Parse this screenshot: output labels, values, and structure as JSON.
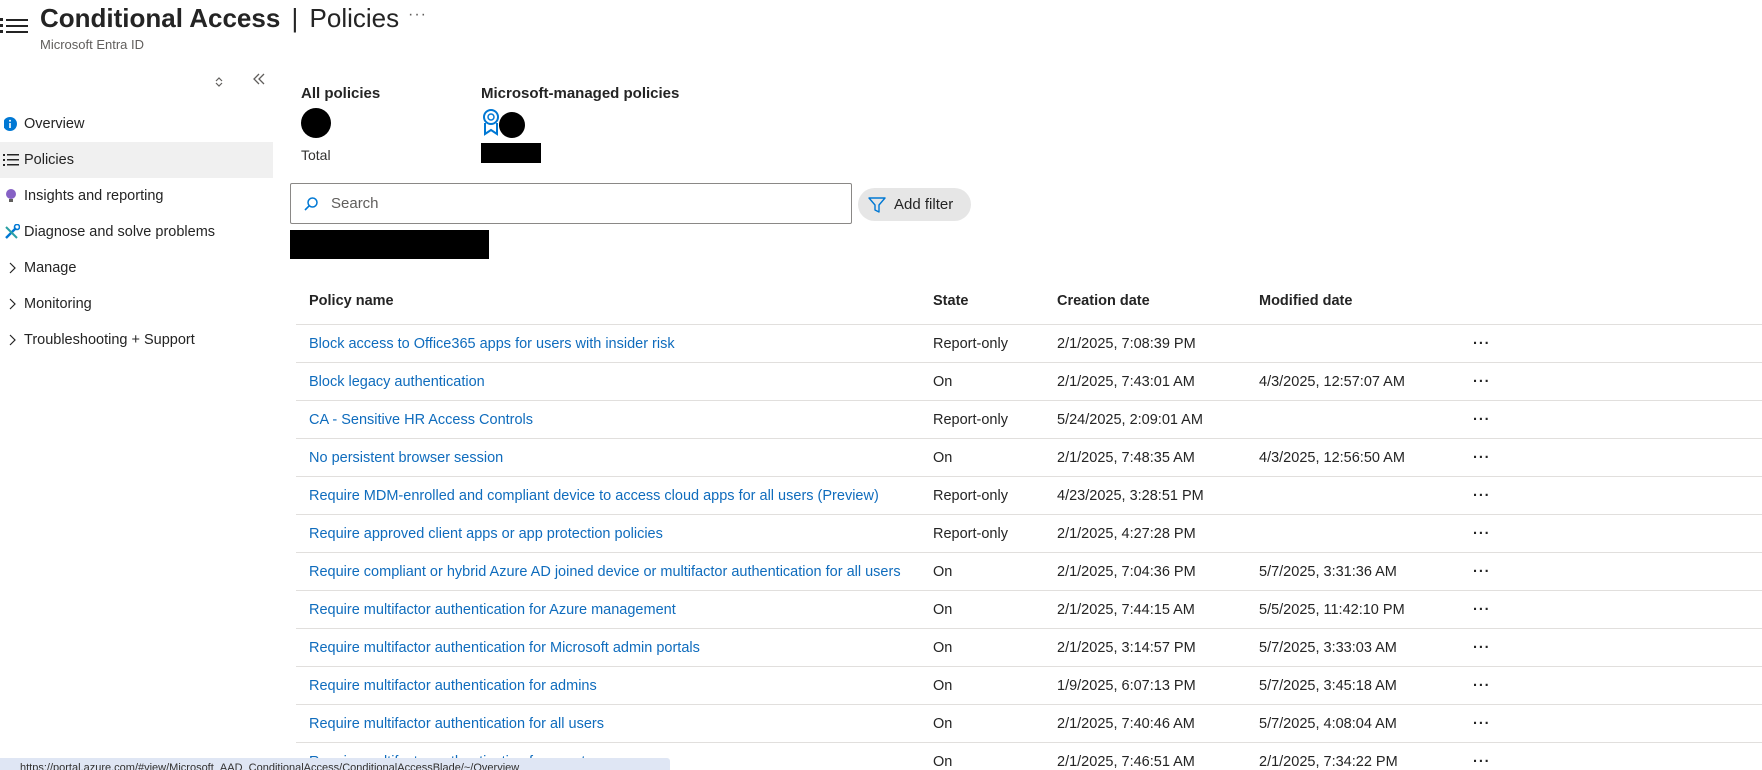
{
  "header": {
    "title_main": "Conditional Access",
    "title_sep": "|",
    "title_sub": "Policies",
    "more": "···",
    "subtitle": "Microsoft Entra ID"
  },
  "sidebar": {
    "items": [
      {
        "label": "Overview",
        "icon": "info-icon",
        "selected": false
      },
      {
        "label": "Policies",
        "icon": "list-icon",
        "selected": true
      },
      {
        "label": "Insights and reporting",
        "icon": "lightbulb-icon",
        "selected": false
      },
      {
        "label": "Diagnose and solve problems",
        "icon": "wrench-icon",
        "selected": false
      },
      {
        "label": "Manage",
        "icon": "chevron-right-icon",
        "selected": false
      },
      {
        "label": "Monitoring",
        "icon": "chevron-right-icon",
        "selected": false
      },
      {
        "label": "Troubleshooting + Support",
        "icon": "chevron-right-icon",
        "selected": false
      }
    ]
  },
  "summary": {
    "all_policies_label": "All policies",
    "total_label": "Total",
    "managed_label": "Microsoft-managed policies"
  },
  "search": {
    "placeholder": "Search",
    "filter_label": "Add filter"
  },
  "table": {
    "headers": {
      "name": "Policy name",
      "state": "State",
      "created": "Creation date",
      "modified": "Modified date"
    },
    "more_label": "···",
    "rows": [
      {
        "name": "Block access to Office365 apps for users with insider risk",
        "state": "Report-only",
        "created": "2/1/2025, 7:08:39 PM",
        "modified": ""
      },
      {
        "name": "Block legacy authentication",
        "state": "On",
        "created": "2/1/2025, 7:43:01 AM",
        "modified": "4/3/2025, 12:57:07 AM"
      },
      {
        "name": "CA - Sensitive HR Access Controls",
        "state": "Report-only",
        "created": "5/24/2025, 2:09:01 AM",
        "modified": ""
      },
      {
        "name": "No persistent browser session",
        "state": "On",
        "created": "2/1/2025, 7:48:35 AM",
        "modified": "4/3/2025, 12:56:50 AM"
      },
      {
        "name": "Require MDM-enrolled and compliant device to access cloud apps for all users (Preview)",
        "state": "Report-only",
        "created": "4/23/2025, 3:28:51 PM",
        "modified": ""
      },
      {
        "name": "Require approved client apps or app protection policies",
        "state": "Report-only",
        "created": "2/1/2025, 4:27:28 PM",
        "modified": ""
      },
      {
        "name": "Require compliant or hybrid Azure AD joined device or multifactor authentication for all users",
        "state": "On",
        "created": "2/1/2025, 7:04:36 PM",
        "modified": "5/7/2025, 3:31:36 AM"
      },
      {
        "name": "Require multifactor authentication for Azure management",
        "state": "On",
        "created": "2/1/2025, 7:44:15 AM",
        "modified": "5/5/2025, 11:42:10 PM"
      },
      {
        "name": "Require multifactor authentication for Microsoft admin portals",
        "state": "On",
        "created": "2/1/2025, 3:14:57 PM",
        "modified": "5/7/2025, 3:33:03 AM"
      },
      {
        "name": "Require multifactor authentication for admins",
        "state": "On",
        "created": "1/9/2025, 6:07:13 PM",
        "modified": "5/7/2025, 3:45:18 AM"
      },
      {
        "name": "Require multifactor authentication for all users",
        "state": "On",
        "created": "2/1/2025, 7:40:46 AM",
        "modified": "5/7/2025, 4:08:04 AM"
      },
      {
        "name": "Require multifactor authentication for guest access",
        "state": "On",
        "created": "2/1/2025, 7:46:51 AM",
        "modified": "2/1/2025, 7:34:22 PM"
      }
    ]
  },
  "status_bar": {
    "text": "https://portal.azure.com/#view/Microsoft_AAD_ConditionalAccess/ConditionalAccessBlade/~/Overview"
  },
  "colors": {
    "link": "#0f6cbd",
    "selected_nav": "#f0f0f0",
    "accent": "#0078d4"
  }
}
